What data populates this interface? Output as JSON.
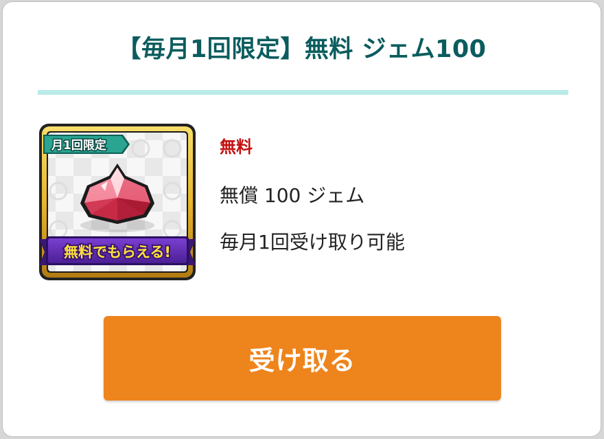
{
  "offer": {
    "title": "【毎月1回限定】無料 ジェム100",
    "price_label": "無料",
    "description_line1": "無償 100 ジェム",
    "description_line2": "毎月1回受け取り可能",
    "claim_button_label": "受け取る"
  },
  "thumbnail": {
    "icon": "red-gem-icon",
    "corner_badge_text": "月1回限定",
    "ribbon_text": "無料でもらえる!"
  },
  "colors": {
    "title": "#0b5c5e",
    "divider": "#b9ebe8",
    "price": "#c40f0f",
    "button": "#ee841c",
    "ribbon": "#5a28a8",
    "badge": "#1d8a7c",
    "frame_gold": "#e7b62b"
  }
}
